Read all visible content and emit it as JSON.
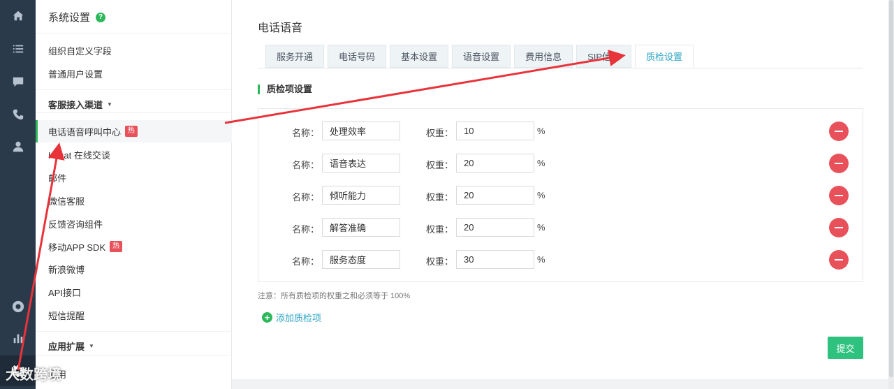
{
  "rail": {
    "icons": [
      "home-icon",
      "list-icon",
      "chat-icon",
      "phone-icon",
      "user-icon",
      "lifebuoy-icon",
      "bar-chart-icon",
      "settings-icon"
    ]
  },
  "sidebar": {
    "title": "系统设置",
    "help": "?",
    "items_top": [
      "组织自定义字段",
      "普通用户设置"
    ],
    "group_channels": "客服接入渠道",
    "channel_items": [
      {
        "label": "电话语音呼叫中心",
        "badge": "热"
      },
      {
        "label": "Kchat 在线交谈",
        "badge": ""
      },
      {
        "label": "邮件",
        "badge": ""
      },
      {
        "label": "微信客服",
        "badge": ""
      },
      {
        "label": "反馈咨询组件",
        "badge": ""
      },
      {
        "label": "移动APP SDK",
        "badge": "热"
      },
      {
        "label": "新浪微博",
        "badge": ""
      },
      {
        "label": "API接口",
        "badge": ""
      },
      {
        "label": "短信提醒",
        "badge": ""
      }
    ],
    "group_apps": "应用扩展",
    "apps_items": [
      "应用"
    ]
  },
  "main": {
    "title": "电话语音",
    "tabs": [
      "服务开通",
      "电话号码",
      "基本设置",
      "语音设置",
      "费用信息",
      "SIP信息",
      "质检设置"
    ],
    "active_tab": 6,
    "section_title": "质检项设置",
    "name_label": "名称：",
    "weight_label": "权重：",
    "percent": "%",
    "rows": [
      {
        "name": "处理效率",
        "weight": "10"
      },
      {
        "name": "语音表达",
        "weight": "20"
      },
      {
        "name": "倾听能力",
        "weight": "20"
      },
      {
        "name": "解答准确",
        "weight": "20"
      },
      {
        "name": "服务态度",
        "weight": "30"
      }
    ],
    "note": "注意：所有质检项的权重之和必须等于 100%",
    "add_label": "添加质检项",
    "submit_label": "提交"
  },
  "watermark": "大数跨境",
  "colors": {
    "accent": "#2db85c",
    "link": "#2aa3c4",
    "danger": "#e8515a",
    "annotation": "#e8333a",
    "rail": "#2b3a4a"
  }
}
